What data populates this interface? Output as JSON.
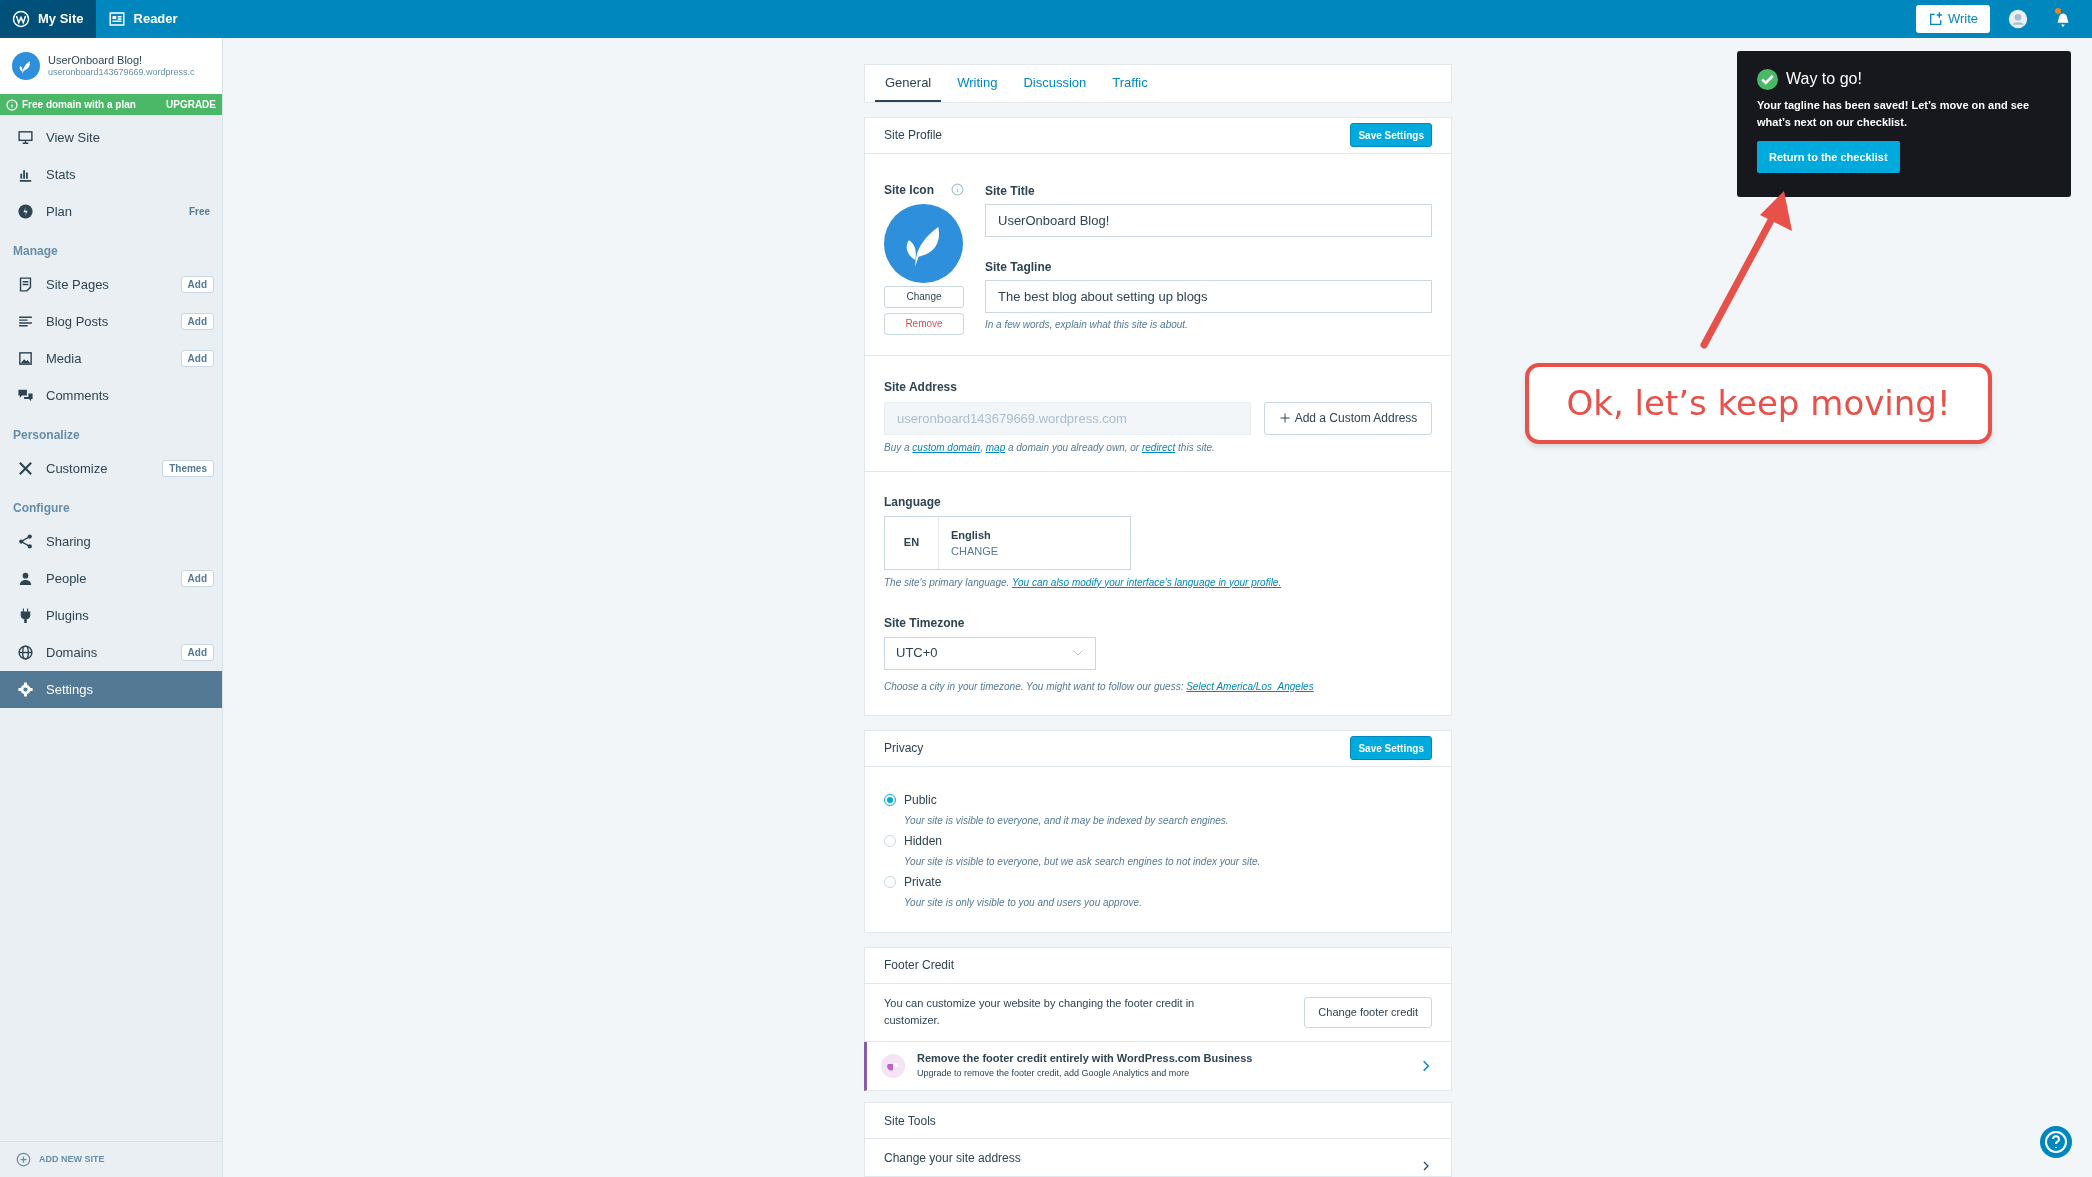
{
  "top_bar": {
    "tabs": [
      {
        "label": "My Site",
        "selected": true
      },
      {
        "label": "Reader",
        "selected": false
      }
    ],
    "write_button": "Write",
    "notifications_unread": true
  },
  "sidebar": {
    "site": {
      "name": "UserOnboard Blog!",
      "url": "useronboard143679669.wordpress.c"
    },
    "banner": {
      "text": "Free domain with a plan",
      "action": "UPGRADE"
    },
    "sections": [
      {
        "items": [
          {
            "label": "View Site",
            "selected": false
          },
          {
            "label": "Stats",
            "selected": false
          },
          {
            "label": "Plan",
            "selected": false,
            "action": {
              "kind": "text",
              "label": "Free"
            }
          }
        ]
      },
      {
        "heading": "Manage",
        "items": [
          {
            "label": "Site Pages",
            "selected": false,
            "action": {
              "kind": "button",
              "label": "Add"
            }
          },
          {
            "label": "Blog Posts",
            "selected": false,
            "action": {
              "kind": "button",
              "label": "Add"
            }
          },
          {
            "label": "Media",
            "selected": false,
            "action": {
              "kind": "button",
              "label": "Add"
            }
          },
          {
            "label": "Comments",
            "selected": false
          }
        ]
      },
      {
        "heading": "Personalize",
        "items": [
          {
            "label": "Customize",
            "selected": false,
            "action": {
              "kind": "button",
              "label": "Themes"
            }
          }
        ]
      },
      {
        "heading": "Configure",
        "items": [
          {
            "label": "Sharing",
            "selected": false
          },
          {
            "label": "People",
            "selected": false,
            "action": {
              "kind": "button",
              "label": "Add"
            }
          },
          {
            "label": "Plugins",
            "selected": false
          },
          {
            "label": "Domains",
            "selected": false,
            "action": {
              "kind": "button",
              "label": "Add"
            }
          },
          {
            "label": "Settings",
            "selected": true
          }
        ]
      }
    ],
    "add_site": "ADD NEW SITE"
  },
  "tabs": [
    {
      "label": "General",
      "selected": true
    },
    {
      "label": "Writing",
      "selected": false
    },
    {
      "label": "Discussion",
      "selected": false
    },
    {
      "label": "Traffic",
      "selected": false
    }
  ],
  "site_profile": {
    "title": "Site Profile",
    "save": "Save Settings",
    "icon_label": "Site Icon",
    "change": "Change",
    "remove": "Remove",
    "site_title": {
      "label": "Site Title",
      "value": "UserOnboard Blog!"
    },
    "tagline": {
      "label": "Site Tagline",
      "value": "The best blog about setting up blogs",
      "help": "In a few words, explain what this site is about."
    }
  },
  "site_address": {
    "label": "Site Address",
    "value": "useronboard143679669.wordpress.com",
    "button": "Add a Custom Address",
    "help": [
      {
        "text": "Buy a ",
        "link": false
      },
      {
        "text": "custom domain",
        "link": true
      },
      {
        "text": ", ",
        "link": false
      },
      {
        "text": "map",
        "link": true
      },
      {
        "text": " a domain you already own, or ",
        "link": false
      },
      {
        "text": "redirect",
        "link": true
      },
      {
        "text": " this site.",
        "link": false
      }
    ]
  },
  "language": {
    "label": "Language",
    "code": "EN",
    "name": "English",
    "change": "CHANGE",
    "help": [
      {
        "text": "The site's primary language. ",
        "link": false
      },
      {
        "text": "You can also modify your interface's language in your profile.",
        "link": true
      }
    ]
  },
  "timezone": {
    "label": "Site Timezone",
    "value": "UTC+0",
    "help": [
      {
        "text": "Choose a city in your timezone. You might want to follow our guess: ",
        "link": false
      },
      {
        "text": "Select America/Los_Angeles",
        "link": true
      }
    ]
  },
  "privacy": {
    "title": "Privacy",
    "save": "Save Settings",
    "options": [
      {
        "label": "Public",
        "description": "Your site is visible to everyone, and it may be indexed by search engines.",
        "selected": true
      },
      {
        "label": "Hidden",
        "description": "Your site is visible to everyone, but we ask search engines to not index your site.",
        "selected": false
      },
      {
        "label": "Private",
        "description": "Your site is only visible to you and users you approve.",
        "selected": false
      }
    ]
  },
  "footer_credit": {
    "title": "Footer Credit",
    "text": "You can customize your website by changing the footer credit in customizer.",
    "button": "Change footer credit",
    "upsell": {
      "title": "Remove the footer credit entirely with WordPress.com Business",
      "subtitle": "Upgrade to remove the footer credit, add Google Analytics and more"
    }
  },
  "site_tools": {
    "title": "Site Tools",
    "rows": [
      "Change your site address"
    ]
  },
  "notice": {
    "title": "Way to go!",
    "message": "Your tagline has been saved! Let’s move on and see what’s next on our checklist.",
    "button": "Return to the checklist"
  },
  "callout": {
    "text": "Ok, let’s keep moving!"
  }
}
